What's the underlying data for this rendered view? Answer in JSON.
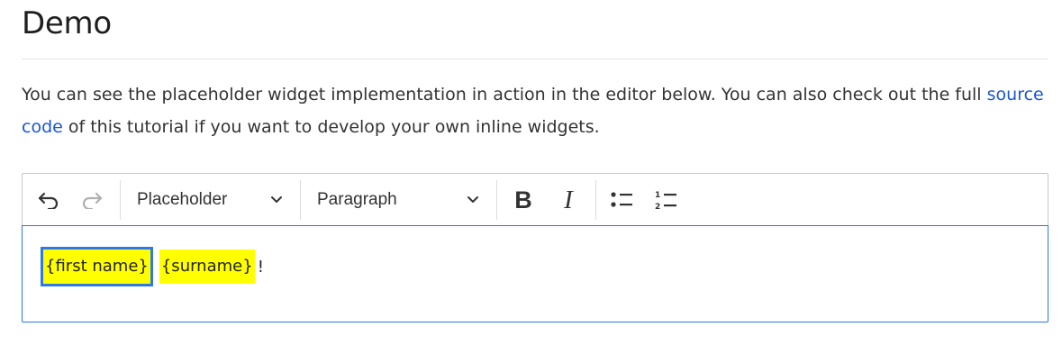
{
  "page": {
    "title": "Demo",
    "intro": {
      "text_before_link": "You can see the placeholder widget implementation in action in the editor below. You can also check out the full ",
      "link_text": "source code",
      "text_after_link": " of this tutorial if you want to develop your own inline widgets."
    }
  },
  "toolbar": {
    "undo_icon": "undo-icon",
    "redo_icon": "redo-icon",
    "placeholder_dropdown_label": "Placeholder",
    "heading_dropdown_label": "Paragraph",
    "bold_icon": "bold-icon",
    "italic_icon": "italic-icon",
    "bulleted_list_icon": "bulleted-list-icon",
    "numbered_list_icon": "numbered-list-icon"
  },
  "editor": {
    "placeholders": [
      "{first name}",
      "{surname}"
    ],
    "trailing_text": "!",
    "colors": {
      "placeholder_highlight": "#ffff00",
      "selection_outline": "#2f79e6",
      "focus_border": "#2977e6",
      "link": "#1a55d8"
    }
  }
}
